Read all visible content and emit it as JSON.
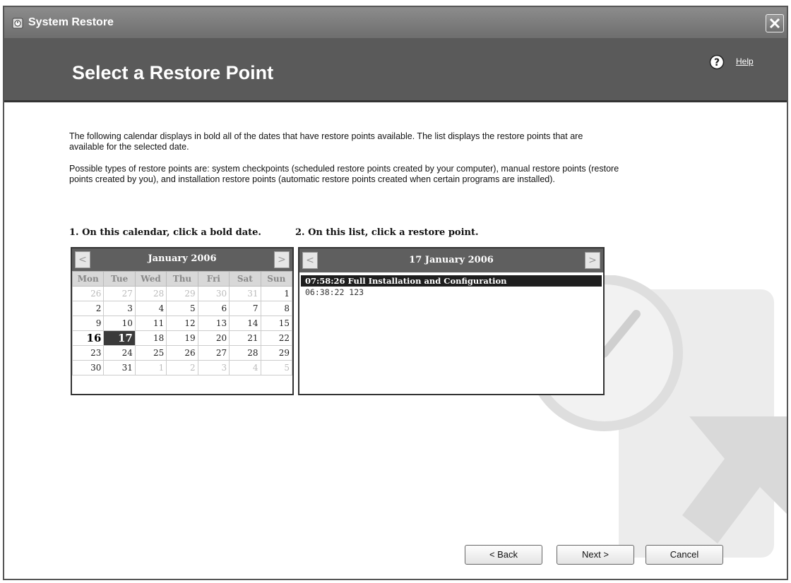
{
  "window": {
    "title": "System Restore"
  },
  "header": {
    "heading": "Select a Restore Point",
    "help_label": "Help"
  },
  "intro": {
    "paragraph1": "The following calendar displays in bold all of the dates that have restore points available. The list displays the restore points that are available for the selected date.",
    "paragraph2": "Possible types of restore points are: system checkpoints (scheduled restore points created by your computer), manual restore points (restore points created by you), and installation restore points (automatic restore points created when certain programs are installed)."
  },
  "steps": {
    "calendar_label": "1. On this calendar, click a bold date.",
    "list_label": "2. On this list, click a restore point."
  },
  "calendar": {
    "month_title": "January 2006",
    "prev_glyph": "<",
    "next_glyph": ">",
    "weekdays": [
      "Mon",
      "Tue",
      "Wed",
      "Thu",
      "Fri",
      "Sat",
      "Sun"
    ],
    "weeks": [
      [
        "26",
        "27",
        "28",
        "29",
        "30",
        "31",
        "1"
      ],
      [
        "2",
        "3",
        "4",
        "5",
        "6",
        "7",
        "8"
      ],
      [
        "9",
        "10",
        "11",
        "12",
        "13",
        "14",
        "15"
      ],
      [
        "16",
        "17",
        "18",
        "19",
        "20",
        "21",
        "22"
      ],
      [
        "23",
        "24",
        "25",
        "26",
        "27",
        "28",
        "29"
      ],
      [
        "30",
        "31",
        "1",
        "2",
        "3",
        "4",
        "5"
      ]
    ],
    "bold_dates": [
      "16"
    ],
    "selected_date": "17"
  },
  "restore_list": {
    "date_title": "17 January 2006",
    "prev_glyph": "<",
    "next_glyph": ">",
    "items": [
      {
        "text": "07:58:26  Full Installation and Configuration",
        "selected": true
      },
      {
        "text": "06:38:22  123",
        "selected": false
      }
    ]
  },
  "buttons": {
    "back": "< Back",
    "next": "Next >",
    "cancel": "Cancel"
  },
  "icons": {
    "app": "system-restore-icon",
    "close": "close-icon",
    "help": "help-icon",
    "background": "clock-arrow-watermark"
  },
  "colors": {
    "title_bar": "#7a7a7a",
    "header_band": "#5a5a5a",
    "calendar_header": "#5f5f5f",
    "selection": "#1e1e1e"
  }
}
